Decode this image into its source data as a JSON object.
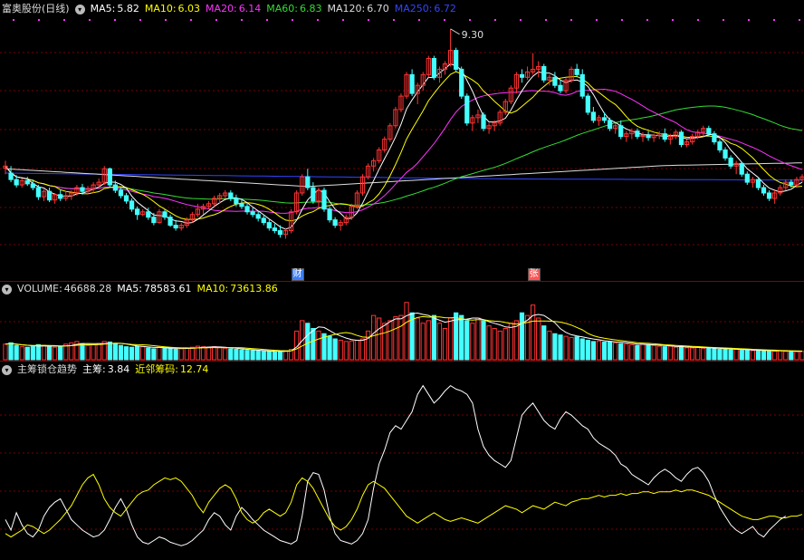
{
  "price_panel": {
    "title": "富奥股份(日线)",
    "ma": [
      {
        "label": "MA5:",
        "value": "5.82",
        "color": "#ffffff"
      },
      {
        "label": "MA10:",
        "value": "6.03",
        "color": "#ffff00"
      },
      {
        "label": "MA20:",
        "value": "6.14",
        "color": "#ff33ff"
      },
      {
        "label": "MA60:",
        "value": "6.83",
        "color": "#33dd33"
      },
      {
        "label": "MA120:",
        "value": "6.70",
        "color": "#dddddd"
      },
      {
        "label": "MA250:",
        "value": "6.72",
        "color": "#3344ff"
      }
    ],
    "high_label": "9.30",
    "events": [
      {
        "label": "财",
        "index": 53,
        "color": "#3a7fff"
      },
      {
        "label": "张",
        "index": 96,
        "color": "#ff5555"
      }
    ]
  },
  "volume_panel": {
    "title": "VOLUME:",
    "volume_value": "46688.28",
    "ma": [
      {
        "label": "MA5:",
        "value": "78583.61",
        "color": "#ffffff"
      },
      {
        "label": "MA10:",
        "value": "73613.86",
        "color": "#ffff00"
      }
    ]
  },
  "indicator_panel": {
    "title": "主筹锁仓趋势",
    "lines": [
      {
        "label": "主筹:",
        "value": "3.84",
        "color": "#ffffff"
      },
      {
        "label": "近邻筹码:",
        "value": "12.74",
        "color": "#ffff00"
      }
    ]
  },
  "colors": {
    "up": "#ff3333",
    "down": "#44ffff",
    "grid": "#7a0000",
    "ma5": "#ffffff",
    "ma10": "#ffff00",
    "ma20": "#ff33ff",
    "ma60": "#33dd33",
    "ma120": "#dddddd",
    "ma250": "#3344ff"
  },
  "chart_data": {
    "type": "candlestick",
    "x_count": 146,
    "price": {
      "ylim": [
        4.7,
        9.5
      ],
      "candles": [
        [
          6.71,
          6.85,
          6.6,
          6.75
        ],
        [
          6.62,
          6.75,
          6.45,
          6.5
        ],
        [
          6.5,
          6.58,
          6.35,
          6.4
        ],
        [
          6.4,
          6.52,
          6.35,
          6.48
        ],
        [
          6.48,
          6.55,
          6.38,
          6.42
        ],
        [
          6.42,
          6.5,
          6.3,
          6.35
        ],
        [
          6.35,
          6.4,
          6.12,
          6.18
        ],
        [
          6.18,
          6.32,
          6.1,
          6.28
        ],
        [
          6.28,
          6.35,
          6.08,
          6.12
        ],
        [
          6.12,
          6.25,
          6.05,
          6.22
        ],
        [
          6.22,
          6.3,
          6.1,
          6.15
        ],
        [
          6.15,
          6.28,
          6.1,
          6.2
        ],
        [
          6.2,
          6.3,
          6.12,
          6.25
        ],
        [
          6.25,
          6.4,
          6.2,
          6.35
        ],
        [
          6.35,
          6.42,
          6.22,
          6.28
        ],
        [
          6.28,
          6.38,
          6.22,
          6.32
        ],
        [
          6.32,
          6.45,
          6.25,
          6.4
        ],
        [
          6.4,
          6.52,
          6.35,
          6.45
        ],
        [
          6.45,
          6.75,
          6.4,
          6.7
        ],
        [
          6.7,
          6.72,
          6.35,
          6.4
        ],
        [
          6.4,
          6.48,
          6.25,
          6.3
        ],
        [
          6.3,
          6.35,
          6.15,
          6.2
        ],
        [
          6.2,
          6.25,
          6.05,
          6.1
        ],
        [
          6.1,
          6.15,
          5.9,
          5.95
        ],
        [
          5.95,
          6.0,
          5.75,
          5.85
        ],
        [
          5.85,
          5.95,
          5.82,
          5.9
        ],
        [
          5.9,
          5.98,
          5.75,
          5.8
        ],
        [
          5.8,
          5.88,
          5.65,
          5.7
        ],
        [
          5.7,
          5.95,
          5.68,
          5.9
        ],
        [
          5.9,
          5.95,
          5.75,
          5.8
        ],
        [
          5.8,
          5.85,
          5.62,
          5.65
        ],
        [
          5.65,
          5.75,
          5.55,
          5.6
        ],
        [
          5.6,
          5.7,
          5.55,
          5.65
        ],
        [
          5.65,
          5.8,
          5.6,
          5.75
        ],
        [
          5.75,
          5.9,
          5.7,
          5.85
        ],
        [
          5.85,
          6.05,
          5.8,
          5.95
        ],
        [
          5.95,
          6.05,
          5.85,
          6.0
        ],
        [
          6.0,
          6.1,
          5.95,
          6.05
        ],
        [
          6.05,
          6.2,
          6.0,
          6.15
        ],
        [
          6.15,
          6.25,
          6.05,
          6.2
        ],
        [
          6.2,
          6.3,
          6.15,
          6.25
        ],
        [
          6.25,
          6.3,
          6.1,
          6.15
        ],
        [
          6.15,
          6.22,
          6.0,
          6.05
        ],
        [
          6.05,
          6.15,
          5.95,
          6.0
        ],
        [
          6.0,
          6.05,
          5.85,
          5.9
        ],
        [
          5.9,
          5.98,
          5.8,
          5.85
        ],
        [
          5.85,
          5.9,
          5.72,
          5.78
        ],
        [
          5.78,
          5.85,
          5.65,
          5.7
        ],
        [
          5.7,
          5.75,
          5.55,
          5.6
        ],
        [
          5.6,
          5.68,
          5.5,
          5.55
        ],
        [
          5.55,
          5.65,
          5.42,
          5.48
        ],
        [
          5.48,
          5.6,
          5.4,
          5.55
        ],
        [
          5.55,
          5.95,
          5.5,
          5.9
        ],
        [
          5.9,
          6.3,
          5.85,
          6.25
        ],
        [
          6.25,
          6.6,
          6.2,
          6.55
        ],
        [
          6.55,
          6.7,
          6.3,
          6.35
        ],
        [
          6.35,
          6.45,
          6.05,
          6.1
        ],
        [
          6.1,
          6.35,
          6.0,
          6.3
        ],
        [
          6.3,
          6.35,
          5.9,
          5.95
        ],
        [
          5.95,
          6.0,
          5.7,
          5.75
        ],
        [
          5.75,
          5.8,
          5.6,
          5.65
        ],
        [
          5.65,
          5.75,
          5.55,
          5.7
        ],
        [
          5.7,
          5.85,
          5.65,
          5.8
        ],
        [
          5.8,
          6.05,
          5.75,
          6.0
        ],
        [
          6.0,
          6.3,
          5.95,
          6.25
        ],
        [
          6.25,
          6.6,
          6.2,
          6.55
        ],
        [
          6.55,
          6.8,
          6.5,
          6.75
        ],
        [
          6.75,
          6.9,
          6.65,
          6.85
        ],
        [
          6.85,
          7.1,
          6.8,
          7.05
        ],
        [
          7.05,
          7.3,
          7.0,
          7.25
        ],
        [
          7.25,
          7.55,
          7.2,
          7.5
        ],
        [
          7.5,
          7.85,
          7.45,
          7.8
        ],
        [
          7.8,
          8.1,
          7.75,
          8.05
        ],
        [
          8.05,
          8.5,
          8.0,
          8.45
        ],
        [
          8.45,
          8.55,
          8.05,
          8.1
        ],
        [
          8.1,
          8.3,
          7.9,
          8.25
        ],
        [
          8.25,
          8.5,
          8.15,
          8.45
        ],
        [
          8.45,
          8.8,
          8.4,
          8.75
        ],
        [
          8.75,
          8.8,
          8.35,
          8.4
        ],
        [
          8.4,
          8.6,
          8.3,
          8.55
        ],
        [
          8.55,
          8.7,
          8.45,
          8.65
        ],
        [
          8.65,
          9.3,
          8.6,
          8.9
        ],
        [
          8.9,
          8.95,
          8.5,
          8.55
        ],
        [
          8.55,
          8.6,
          8.0,
          8.05
        ],
        [
          8.05,
          8.1,
          7.5,
          7.55
        ],
        [
          7.55,
          7.7,
          7.4,
          7.65
        ],
        [
          7.65,
          7.8,
          7.55,
          7.7
        ],
        [
          7.7,
          7.75,
          7.4,
          7.45
        ],
        [
          7.45,
          7.55,
          7.35,
          7.5
        ],
        [
          7.5,
          7.6,
          7.4,
          7.55
        ],
        [
          7.55,
          7.8,
          7.5,
          7.75
        ],
        [
          7.75,
          8.0,
          7.7,
          7.95
        ],
        [
          7.95,
          8.25,
          7.9,
          8.2
        ],
        [
          8.2,
          8.5,
          8.1,
          8.45
        ],
        [
          8.45,
          8.55,
          8.3,
          8.4
        ],
        [
          8.4,
          8.6,
          8.35,
          8.5
        ],
        [
          8.5,
          8.85,
          8.45,
          8.55
        ],
        [
          8.55,
          8.7,
          8.4,
          8.6
        ],
        [
          8.6,
          8.65,
          8.3,
          8.35
        ],
        [
          8.35,
          8.45,
          8.25,
          8.4
        ],
        [
          8.4,
          8.5,
          8.2,
          8.25
        ],
        [
          8.25,
          8.35,
          8.1,
          8.15
        ],
        [
          8.15,
          8.4,
          8.1,
          8.35
        ],
        [
          8.35,
          8.6,
          8.3,
          8.55
        ],
        [
          8.55,
          8.65,
          8.4,
          8.45
        ],
        [
          8.45,
          8.55,
          8.0,
          8.05
        ],
        [
          8.05,
          8.1,
          7.7,
          7.75
        ],
        [
          7.75,
          7.85,
          7.55,
          7.6
        ],
        [
          7.6,
          7.7,
          7.5,
          7.65
        ],
        [
          7.65,
          7.75,
          7.55,
          7.6
        ],
        [
          7.6,
          7.65,
          7.4,
          7.45
        ],
        [
          7.45,
          7.55,
          7.35,
          7.5
        ],
        [
          7.5,
          7.6,
          7.25,
          7.3
        ],
        [
          7.3,
          7.4,
          7.2,
          7.35
        ],
        [
          7.35,
          7.45,
          7.25,
          7.4
        ],
        [
          7.4,
          7.45,
          7.25,
          7.3
        ],
        [
          7.3,
          7.38,
          7.2,
          7.32
        ],
        [
          7.32,
          7.4,
          7.22,
          7.28
        ],
        [
          7.28,
          7.35,
          7.2,
          7.32
        ],
        [
          7.32,
          7.4,
          7.25,
          7.35
        ],
        [
          7.35,
          7.45,
          7.2,
          7.25
        ],
        [
          7.25,
          7.35,
          7.15,
          7.3
        ],
        [
          7.3,
          7.42,
          7.25,
          7.38
        ],
        [
          7.38,
          7.42,
          7.1,
          7.15
        ],
        [
          7.15,
          7.25,
          7.1,
          7.2
        ],
        [
          7.2,
          7.35,
          7.15,
          7.3
        ],
        [
          7.3,
          7.42,
          7.25,
          7.38
        ],
        [
          7.38,
          7.5,
          7.3,
          7.45
        ],
        [
          7.45,
          7.5,
          7.3,
          7.35
        ],
        [
          7.35,
          7.4,
          7.15,
          7.2
        ],
        [
          7.2,
          7.25,
          7.0,
          7.05
        ],
        [
          7.05,
          7.1,
          6.85,
          6.9
        ],
        [
          6.9,
          6.95,
          6.7,
          6.75
        ],
        [
          6.75,
          6.85,
          6.6,
          6.8
        ],
        [
          6.8,
          6.82,
          6.55,
          6.6
        ],
        [
          6.6,
          6.65,
          6.4,
          6.45
        ],
        [
          6.45,
          6.55,
          6.35,
          6.5
        ],
        [
          6.5,
          6.52,
          6.3,
          6.35
        ],
        [
          6.35,
          6.4,
          6.2,
          6.25
        ],
        [
          6.25,
          6.3,
          6.1,
          6.15
        ],
        [
          6.15,
          6.3,
          6.05,
          6.25
        ],
        [
          6.25,
          6.4,
          6.2,
          6.35
        ],
        [
          6.35,
          6.5,
          6.3,
          6.45
        ],
        [
          6.45,
          6.5,
          6.35,
          6.4
        ],
        [
          6.4,
          6.55,
          6.35,
          6.5
        ],
        [
          6.5,
          6.6,
          6.45,
          6.55
        ]
      ]
    },
    "volume": {
      "ylim": [
        0,
        240000
      ],
      "values": [
        60000,
        65000,
        55000,
        50000,
        48000,
        52000,
        58000,
        55000,
        50000,
        48000,
        52000,
        60000,
        65000,
        70000,
        62000,
        55000,
        58000,
        62000,
        70000,
        68000,
        60000,
        55000,
        50000,
        48000,
        52000,
        50000,
        45000,
        42000,
        48000,
        46000,
        44000,
        40000,
        42000,
        45000,
        48000,
        52000,
        50000,
        48000,
        50000,
        46000,
        44000,
        42000,
        40000,
        38000,
        36000,
        35000,
        34000,
        33000,
        32000,
        30000,
        32000,
        34000,
        40000,
        110000,
        150000,
        140000,
        120000,
        110000,
        100000,
        90000,
        80000,
        75000,
        70000,
        72000,
        75000,
        80000,
        110000,
        170000,
        160000,
        140000,
        150000,
        165000,
        170000,
        220000,
        180000,
        160000,
        140000,
        150000,
        170000,
        140000,
        120000,
        160000,
        180000,
        170000,
        150000,
        140000,
        160000,
        150000,
        130000,
        120000,
        110000,
        120000,
        140000,
        150000,
        180000,
        170000,
        210000,
        160000,
        130000,
        110000,
        100000,
        95000,
        90000,
        85000,
        88000,
        80000,
        75000,
        70000,
        72000,
        68000,
        70000,
        65000,
        62000,
        60000,
        58000,
        55000,
        60000,
        58000,
        55000,
        52000,
        50000,
        52000,
        48000,
        50000,
        46000,
        45000,
        48000,
        44000,
        46000,
        42000,
        40000,
        42000,
        38000,
        40000,
        36000,
        38000,
        35000,
        36000,
        34000,
        35000,
        33000,
        34000,
        32000,
        33000,
        31000,
        32000
      ],
      "ma5_last": 78583.61,
      "ma10_last": 73613.86
    },
    "indicator": {
      "ylim": [
        0,
        100
      ],
      "zhuchou": [
        18,
        12,
        22,
        15,
        10,
        8,
        12,
        20,
        25,
        28,
        30,
        24,
        18,
        15,
        12,
        10,
        8,
        9,
        12,
        18,
        25,
        30,
        24,
        15,
        8,
        5,
        4,
        6,
        8,
        7,
        5,
        4,
        3,
        4,
        6,
        9,
        12,
        18,
        22,
        20,
        15,
        12,
        20,
        25,
        22,
        18,
        15,
        12,
        10,
        8,
        6,
        5,
        4,
        6,
        20,
        40,
        45,
        44,
        35,
        20,
        10,
        6,
        5,
        4,
        6,
        10,
        18,
        36,
        50,
        58,
        68,
        72,
        70,
        75,
        80,
        90,
        95,
        90,
        85,
        88,
        92,
        95,
        93,
        92,
        90,
        85,
        70,
        60,
        55,
        52,
        50,
        48,
        52,
        65,
        78,
        82,
        85,
        80,
        75,
        72,
        70,
        76,
        80,
        78,
        75,
        72,
        70,
        65,
        62,
        60,
        58,
        55,
        50,
        48,
        44,
        42,
        40,
        38,
        42,
        45,
        47,
        45,
        42,
        40,
        44,
        47,
        48,
        45,
        40,
        32,
        25,
        20,
        15,
        12,
        10,
        12,
        14,
        10,
        8,
        12,
        15,
        18,
        20
      ],
      "jinlin": [
        10,
        8,
        10,
        12,
        15,
        14,
        12,
        10,
        12,
        15,
        18,
        22,
        26,
        32,
        38,
        42,
        44,
        38,
        30,
        25,
        22,
        20,
        24,
        28,
        32,
        34,
        35,
        38,
        40,
        42,
        41,
        42,
        40,
        36,
        32,
        26,
        22,
        28,
        32,
        36,
        38,
        36,
        30,
        22,
        18,
        16,
        18,
        22,
        24,
        22,
        20,
        22,
        28,
        38,
        42,
        40,
        36,
        30,
        24,
        18,
        14,
        12,
        14,
        18,
        24,
        32,
        38,
        40,
        38,
        36,
        32,
        28,
        24,
        20,
        18,
        16,
        18,
        20,
        22,
        20,
        18,
        17,
        18,
        19,
        18,
        17,
        16,
        18,
        20,
        22,
        24,
        26,
        25,
        24,
        22,
        24,
        26,
        25,
        24,
        26,
        28,
        27,
        26,
        28,
        29,
        30,
        30,
        31,
        32,
        31,
        32,
        32,
        33,
        32,
        33,
        33,
        34,
        34,
        33,
        34,
        34,
        34,
        35,
        34,
        35,
        35,
        34,
        33,
        32,
        30,
        28,
        26,
        24,
        22,
        20,
        19,
        18,
        18,
        19,
        20,
        20,
        19,
        19,
        20,
        20,
        21
      ]
    }
  }
}
